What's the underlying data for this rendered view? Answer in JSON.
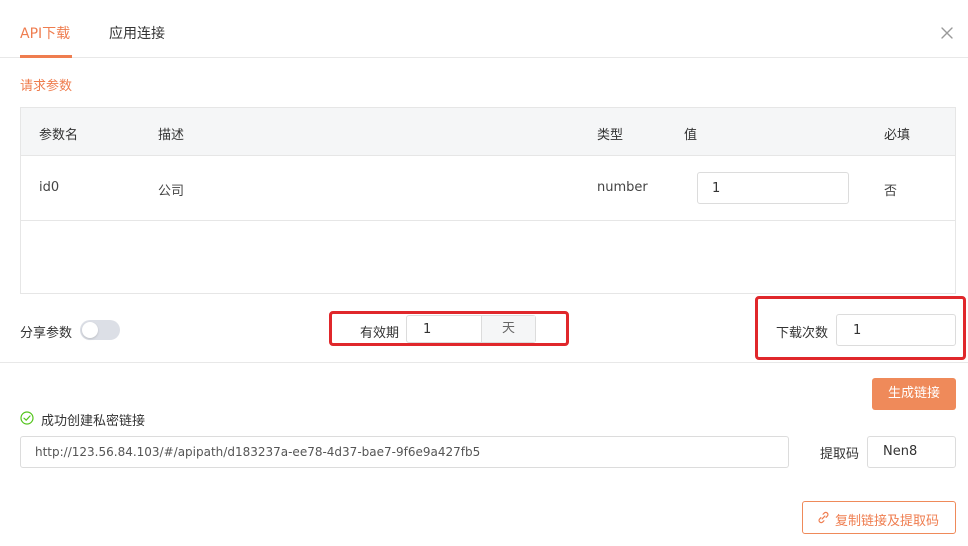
{
  "tabs": [
    {
      "label": "API下载",
      "active": true
    },
    {
      "label": "应用连接",
      "active": false
    }
  ],
  "section": {
    "title": "请求参数"
  },
  "table": {
    "headers": [
      "参数名",
      "描述",
      "类型",
      "值",
      "必填"
    ],
    "rows": [
      {
        "name": "id0",
        "description": "公司",
        "type": "number",
        "value": "1",
        "required": "否"
      }
    ]
  },
  "share": {
    "label": "分享参数",
    "enabled": false
  },
  "validity": {
    "label": "有效期",
    "value": "1",
    "unit": "天"
  },
  "download_count": {
    "label": "下载次数",
    "value": "1"
  },
  "generate_button": {
    "label": "生成链接"
  },
  "success": {
    "message": "成功创建私密链接"
  },
  "link": {
    "url": "http://123.56.84.103/#/apipath/d183237a-ee78-4d37-bae7-9f6e9a427fb5",
    "code_label": "提取码",
    "code": "Nen8"
  },
  "copy_button": {
    "label": "复制链接及提取码"
  },
  "colors": {
    "accent": "#ef7d4f",
    "highlight": "#e0272b",
    "success": "#52c41a"
  }
}
